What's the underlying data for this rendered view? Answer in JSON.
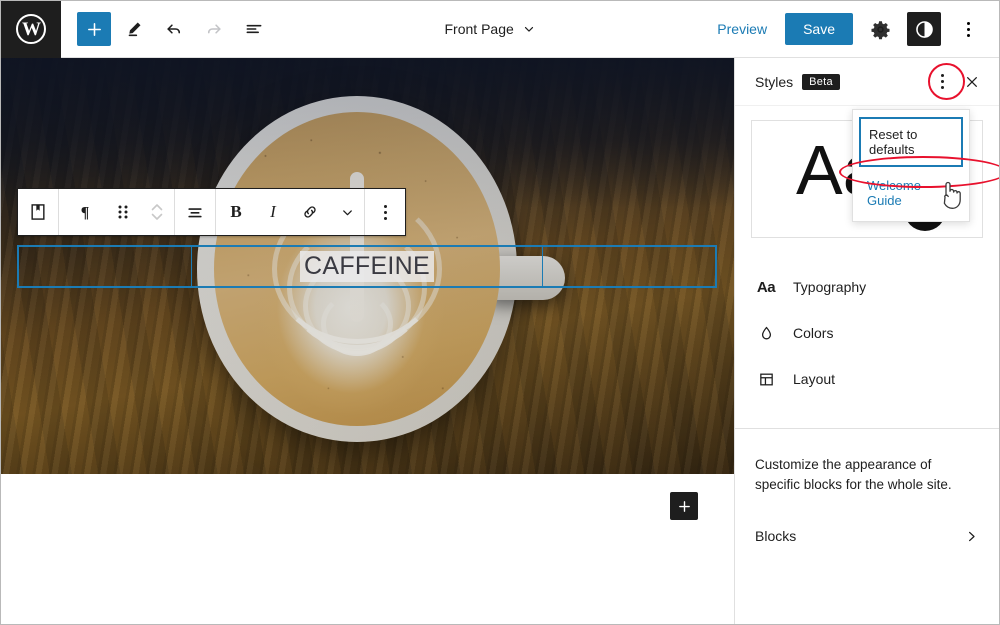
{
  "app": {
    "name": "WordPress Site Editor"
  },
  "topbar": {
    "logo_icon": "wordpress-logo-icon",
    "logo_letter": "W",
    "add_block_label": "+",
    "add_block_icon": "plus-icon",
    "tools_icon": "pencil-edit-icon",
    "undo_icon": "undo-arrow-icon",
    "redo_icon": "redo-arrow-icon",
    "list_view_icon": "list-view-icon",
    "document_title": "Front Page",
    "document_chevron_icon": "chevron-down-icon",
    "preview_label": "Preview",
    "save_label": "Save",
    "settings_icon": "gear-icon",
    "styles_icon": "contrast-half-circle-icon",
    "options_icon": "kebab-menu-icon",
    "accent_color": "#1b7bb4",
    "dark_color": "#1e1e1e"
  },
  "block_toolbar": {
    "cover_block_icon": "cover-block-icon",
    "paragraph_icon": "paragraph-pilcrow-icon",
    "drag_icon": "drag-handle-dots-icon",
    "move_updown_icon": "move-up-down-chevrons-icon",
    "align_icon": "align-text-icon",
    "bold_label": "B",
    "italic_label": "I",
    "link_icon": "link-icon",
    "more_formats_icon": "chevron-down-icon",
    "options_icon": "kebab-menu-icon"
  },
  "canvas": {
    "cover_block_name": "cover-block",
    "heading_text": "CAFFEINE",
    "selection_color": "#1b7bb4",
    "appender_label": "+",
    "appender_icon": "plus-icon",
    "image_description": "overhead photo of a latte with rosetta art on a dark wooden table"
  },
  "sidebar": {
    "title": "Styles",
    "badge": "Beta",
    "options_icon": "kebab-menu-icon",
    "close_icon": "close-x-icon",
    "preview": {
      "type_sample": "Aa",
      "swatch_color": "#111111"
    },
    "items": [
      {
        "label": "Typography",
        "icon": "typography-aa-icon",
        "glyph": "Aa"
      },
      {
        "label": "Colors",
        "icon": "color-droplet-icon",
        "glyph": ""
      },
      {
        "label": "Layout",
        "icon": "layout-grid-icon",
        "glyph": ""
      }
    ],
    "blocks_description": "Customize the appearance of specific blocks for the whole site.",
    "blocks_label": "Blocks",
    "blocks_chevron_icon": "chevron-right-icon"
  },
  "styles_menu": {
    "reset_label": "Reset to defaults",
    "welcome_label": "Welcome Guide"
  },
  "annotations": {
    "color": "#e8112d",
    "kebab_highlight": "circle around styles options kebab menu",
    "welcome_highlight": "ellipse around Welcome Guide menu item",
    "cursor": "pointing-hand-cursor"
  }
}
